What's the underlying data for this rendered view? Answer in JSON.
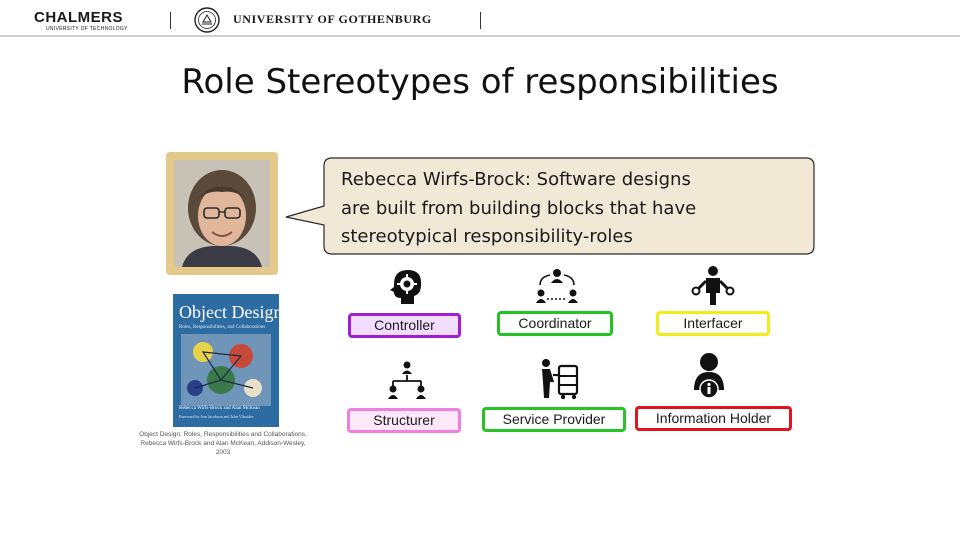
{
  "header": {
    "chalmers_name": "CHALMERS",
    "chalmers_sub": "UNIVERSITY OF TECHNOLOGY",
    "gu_name": "UNIVERSITY OF GOTHENBURG"
  },
  "slide": {
    "title": "Role Stereotypes of responsibilities",
    "quote_lines": [
      "Rebecca Wirfs-Brock: Software designs",
      "are built from building blocks that have",
      "stereotypical responsibility-roles"
    ]
  },
  "book": {
    "title": "Object Design",
    "subtitle": "Roles, Responsibilities, and Collaborations",
    "authors": "Rebecca Wirfs-Brock and Alan McKean",
    "series": "Foreword by Ivar Jacobson and John Vlissides",
    "caption_lines": [
      "Object Design: Roles, Responsibilities and Collaborations,",
      "Rebecca Wirfs-Brock and Alan McKean, Addison-Wesley,",
      "2003"
    ]
  },
  "roles": {
    "controller": {
      "label": "Controller",
      "border": "#a01fd1",
      "fill": "#f2dcff",
      "icon": "brain-gear-icon"
    },
    "coordinator": {
      "label": "Coordinator",
      "border": "#22c422",
      "fill": "#ffffff",
      "icon": "network-people-icon"
    },
    "interfacer": {
      "label": "Interfacer",
      "border": "#f2ec1a",
      "fill": "#ffffff",
      "icon": "person-connectors-icon"
    },
    "structurer": {
      "label": "Structurer",
      "border": "#f07fe0",
      "fill": "#ffe8fb",
      "icon": "hierarchy-people-icon"
    },
    "service_provider": {
      "label": "Service Provider",
      "border": "#27c427",
      "fill": "#ffffff",
      "icon": "trolley-worker-icon"
    },
    "information_holder": {
      "label": "Information Holder",
      "border": "#e0141c",
      "fill": "#ffffff",
      "icon": "person-info-icon"
    }
  },
  "colors": {
    "bubble_fill": "#f2e8d6",
    "bubble_border": "#2a2a2a",
    "portrait_frame": "#e3c98a",
    "book_cover": "#2d6ca3"
  }
}
